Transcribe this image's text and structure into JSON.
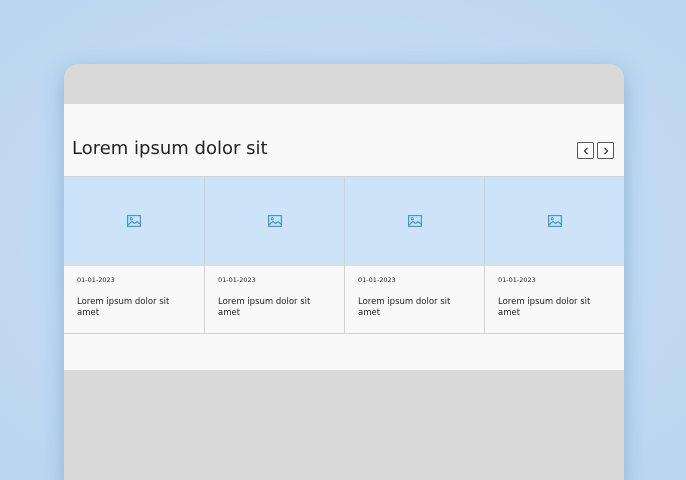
{
  "section": {
    "title": "Lorem ipsum dolor sit"
  },
  "nav": {
    "prev_icon": "chevron-left-icon",
    "next_icon": "chevron-right-icon"
  },
  "cards": [
    {
      "date": "01-01-2023",
      "title": "Lorem ipsum dolor sit amet",
      "icon": "image-icon"
    },
    {
      "date": "01-01-2023",
      "title": "Lorem ipsum dolor sit amet",
      "icon": "image-icon"
    },
    {
      "date": "01-01-2023",
      "title": "Lorem ipsum dolor sit amet",
      "icon": "image-icon"
    },
    {
      "date": "01-01-2023",
      "title": "Lorem ipsum dolor sit amet",
      "icon": "image-icon"
    }
  ],
  "colors": {
    "background": "#c3dcf2",
    "frame": "#d9d9d9",
    "panel": "#f9f9f9",
    "media": "#cde3f8",
    "accent_icon": "#3b8de0",
    "text": "#222222"
  }
}
